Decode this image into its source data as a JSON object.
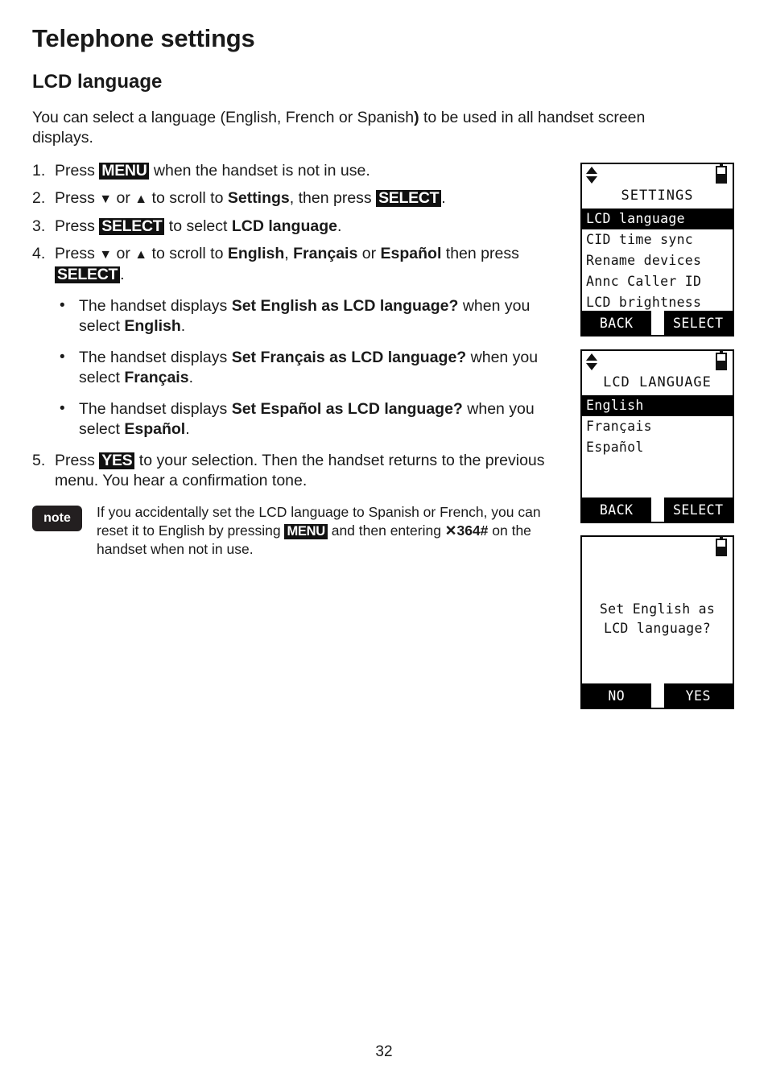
{
  "document": {
    "chapter_title": "Telephone settings",
    "section_title": "LCD language",
    "intro_a": "You can select a language (English, French or Spanish",
    "intro_b": ")",
    "intro_c": " to be used in all handset screen displays.",
    "page_number": "32"
  },
  "steps": [
    {
      "num": "1.",
      "parts": [
        {
          "t": "Press ",
          "s": "plain"
        },
        {
          "t": "MENU",
          "s": "key"
        },
        {
          "t": " when the handset is not in use.",
          "s": "plain"
        }
      ]
    },
    {
      "num": "2.",
      "parts": [
        {
          "t": "Press ",
          "s": "plain"
        },
        {
          "t": "▼",
          "s": "arrow"
        },
        {
          "t": " or ",
          "s": "plain"
        },
        {
          "t": "▲",
          "s": "arrow"
        },
        {
          "t": " to scroll to ",
          "s": "plain"
        },
        {
          "t": "Settings",
          "s": "bold"
        },
        {
          "t": ", then press ",
          "s": "plain"
        },
        {
          "t": "SELECT",
          "s": "key"
        },
        {
          "t": ".",
          "s": "plain"
        }
      ]
    },
    {
      "num": "3.",
      "parts": [
        {
          "t": "Press ",
          "s": "plain"
        },
        {
          "t": "SELECT",
          "s": "key"
        },
        {
          "t": " to select ",
          "s": "plain"
        },
        {
          "t": "LCD language",
          "s": "bold"
        },
        {
          "t": ".",
          "s": "plain"
        }
      ]
    },
    {
      "num": "4.",
      "parts": [
        {
          "t": "Press ",
          "s": "plain"
        },
        {
          "t": "▼",
          "s": "arrow"
        },
        {
          "t": " or ",
          "s": "plain"
        },
        {
          "t": "▲",
          "s": "arrow"
        },
        {
          "t": " to scroll to ",
          "s": "plain"
        },
        {
          "t": "English",
          "s": "bold"
        },
        {
          "t": ", ",
          "s": "plain"
        },
        {
          "t": "Français",
          "s": "bold"
        },
        {
          "t": " or ",
          "s": "plain"
        },
        {
          "t": "Español",
          "s": "bold"
        },
        {
          "t": " then press ",
          "s": "plain"
        },
        {
          "t": "SELECT",
          "s": "key"
        },
        {
          "t": ".",
          "s": "plain"
        }
      ]
    }
  ],
  "bullets": [
    {
      "parts": [
        {
          "t": "The handset displays ",
          "s": "plain"
        },
        {
          "t": "Set English as LCD language?",
          "s": "bold"
        },
        {
          "t": " when you select ",
          "s": "plain"
        },
        {
          "t": "English",
          "s": "bold"
        },
        {
          "t": ".",
          "s": "plain"
        }
      ]
    },
    {
      "parts": [
        {
          "t": "The handset displays ",
          "s": "plain"
        },
        {
          "t": "Set Français as LCD language?",
          "s": "bold"
        },
        {
          "t": " when you select ",
          "s": "plain"
        },
        {
          "t": "Français",
          "s": "bold"
        },
        {
          "t": ".",
          "s": "plain"
        }
      ]
    },
    {
      "parts": [
        {
          "t": "The handset displays ",
          "s": "plain"
        },
        {
          "t": "Set Español as LCD language?",
          "s": "bold"
        },
        {
          "t": " when you select ",
          "s": "plain"
        },
        {
          "t": "Español",
          "s": "bold"
        },
        {
          "t": ".",
          "s": "plain"
        }
      ]
    }
  ],
  "step5": {
    "num": "5.",
    "parts": [
      {
        "t": "Press ",
        "s": "plain"
      },
      {
        "t": "YES",
        "s": "key"
      },
      {
        "t": " to your selection. Then the handset returns to the previous menu. You hear a confirmation tone.",
        "s": "plain"
      }
    ]
  },
  "note": {
    "badge_label": "note",
    "parts": [
      {
        "t": "If you accidentally set the LCD language to Spanish or French, you can reset it to English by pressing ",
        "s": "plain"
      },
      {
        "t": "MENU",
        "s": "key"
      },
      {
        "t": " and then entering ",
        "s": "plain"
      },
      {
        "t": "✕364#",
        "s": "bold"
      },
      {
        "t": " on the handset when not in use.",
        "s": "plain"
      }
    ]
  },
  "bullet_glyph": "•",
  "lcd_screens": [
    {
      "id": "settings",
      "status": {
        "scroll_indicator": "up-down-arrows",
        "battery": "battery-half"
      },
      "title": "SETTINGS",
      "rows": [
        {
          "label": "LCD language",
          "selected": true
        },
        {
          "label": "CID time sync",
          "selected": false
        },
        {
          "label": "Rename devices",
          "selected": false
        },
        {
          "label": "Annc Caller ID",
          "selected": false
        },
        {
          "label": "LCD brightness",
          "selected": false
        }
      ],
      "softkeys": {
        "left": "BACK",
        "right": "SELECT"
      }
    },
    {
      "id": "lcd-language",
      "status": {
        "scroll_indicator": "up-down-arrows",
        "battery": "battery-half"
      },
      "title": "LCD LANGUAGE",
      "rows": [
        {
          "label": "English",
          "selected": true
        },
        {
          "label": "Français",
          "selected": false
        },
        {
          "label": "Español",
          "selected": false
        }
      ],
      "softkeys": {
        "left": "BACK",
        "right": "SELECT"
      }
    },
    {
      "id": "confirm",
      "status": {
        "scroll_indicator": "",
        "battery": "battery-half"
      },
      "title": "",
      "message_lines": [
        "Set English as",
        "LCD language?"
      ],
      "softkeys": {
        "left": "NO",
        "right": "YES"
      }
    }
  ]
}
